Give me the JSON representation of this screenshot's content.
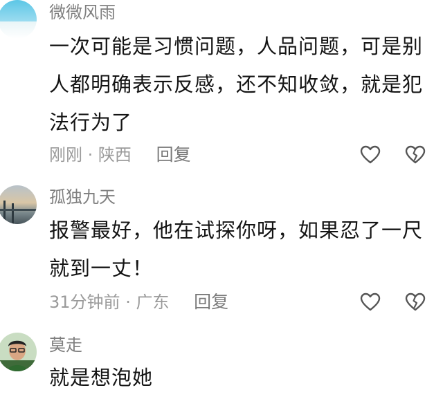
{
  "comments": [
    {
      "username": "微微风雨",
      "text": "一次可能是习惯问题，人品问题，可是别人都明确表示反感，还不知收敛，就是犯法行为了",
      "time": "刚刚",
      "sep": "·",
      "location": "陕西",
      "reply_label": "回复",
      "like_icon": "heart-outline-icon",
      "dislike_icon": "broken-heart-icon"
    },
    {
      "username": "孤独九天",
      "text": "报警最好，他在试探你呀，如果忍了一尺就到一丈！",
      "time": "31分钟前",
      "sep": "·",
      "location": "广东",
      "reply_label": "回复",
      "like_icon": "heart-outline-icon",
      "dislike_icon": "broken-heart-icon"
    },
    {
      "username": "莫走",
      "text": "就是想泡她"
    }
  ],
  "colors": {
    "username": "#7f7f7f",
    "meta": "#9a9a9a",
    "text": "#141414",
    "icon": "#555555"
  }
}
